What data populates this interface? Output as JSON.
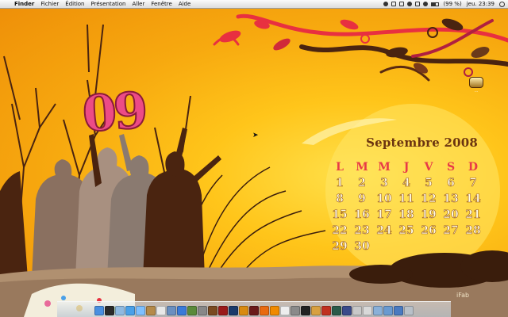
{
  "menubar": {
    "apple_glyph": "",
    "items": [
      "Finder",
      "Fichier",
      "Édition",
      "Présentation",
      "Aller",
      "Fenêtre",
      "Aide"
    ],
    "battery_text": "(99 %)",
    "clock": "jeu. 23:39"
  },
  "desktop": {
    "big_date": "09",
    "calendar": {
      "title": "Septembre 2008",
      "weekdays": [
        "L",
        "M",
        "M",
        "J",
        "V",
        "S",
        "D"
      ],
      "days": [
        "1",
        "2",
        "3",
        "4",
        "5",
        "6",
        "7",
        "8",
        "9",
        "10",
        "11",
        "12",
        "13",
        "14",
        "15",
        "16",
        "17",
        "18",
        "19",
        "20",
        "21",
        "22",
        "23",
        "24",
        "25",
        "26",
        "27",
        "28",
        "29",
        "30"
      ]
    },
    "icon_label": "...",
    "watermark": " iFab",
    "cursor_glyph": "➤"
  },
  "colors": {
    "background": "#ffc51a",
    "big_date": "#ec4b86",
    "weekday_header": "#e83a47",
    "silhouette_dark": "#4a2410",
    "silhouette_light": "#8a7060",
    "vine_red": "#e83040"
  },
  "dock": {
    "icons": [
      {
        "name": "finder-icon",
        "color": "#4a8fe0"
      },
      {
        "name": "dashboard-icon",
        "color": "#2a2a2a"
      },
      {
        "name": "mail-icon",
        "color": "#8fb9e0"
      },
      {
        "name": "safari-icon",
        "color": "#4aa0e8"
      },
      {
        "name": "ichat-icon",
        "color": "#7fc0ff"
      },
      {
        "name": "address-book-icon",
        "color": "#b58a4a"
      },
      {
        "name": "ical-icon",
        "color": "#e8e8e8"
      },
      {
        "name": "preview-icon",
        "color": "#6a8fc0"
      },
      {
        "name": "itunes-icon",
        "color": "#3a7ad8"
      },
      {
        "name": "iphoto-icon",
        "color": "#5a8a3a"
      },
      {
        "name": "imovie-icon",
        "color": "#888888"
      },
      {
        "name": "bridge-icon",
        "color": "#7a4a20"
      },
      {
        "name": "flash-icon",
        "color": "#9a1a1a"
      },
      {
        "name": "photoshop-icon",
        "color": "#1a3a6a"
      },
      {
        "name": "illustrator-icon",
        "color": "#d88a10"
      },
      {
        "name": "fireworks-icon",
        "color": "#6a1a1a"
      },
      {
        "name": "firefox-icon",
        "color": "#e86a10"
      },
      {
        "name": "vlc-icon",
        "color": "#f08a00"
      },
      {
        "name": "textedit-icon",
        "color": "#eeeeee"
      },
      {
        "name": "system-preferences-icon",
        "color": "#8a8a8a"
      },
      {
        "name": "terminal-icon",
        "color": "#222222"
      },
      {
        "name": "transmit-icon",
        "color": "#d8a040"
      },
      {
        "name": "toolbox-icon",
        "color": "#c03020"
      },
      {
        "name": "timemachine-icon",
        "color": "#2a5a4a"
      },
      {
        "name": "spaces-icon",
        "color": "#3a4a8a"
      },
      {
        "name": "cyberduck-icon",
        "color": "#c8c8c8"
      },
      {
        "name": "utilities-icon",
        "color": "#d8d8d8"
      },
      {
        "name": "downloads-icon",
        "color": "#8ab0d8"
      },
      {
        "name": "documents-icon",
        "color": "#6a9ad0"
      },
      {
        "name": "applications-icon",
        "color": "#4a7ac0"
      },
      {
        "name": "trash-icon",
        "color": "#b8c0c8"
      }
    ]
  }
}
